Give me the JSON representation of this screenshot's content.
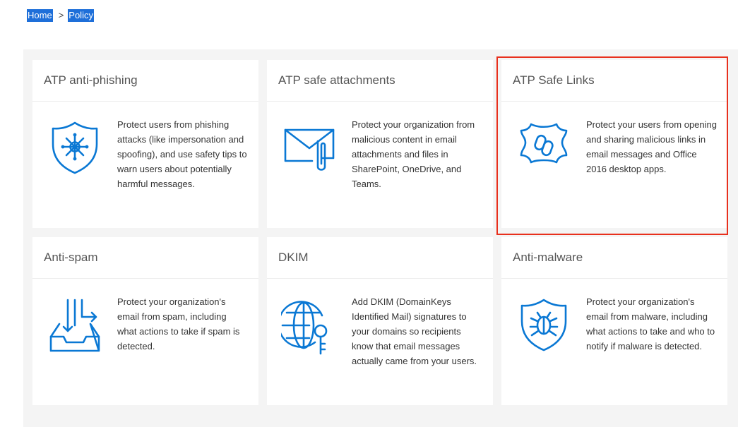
{
  "breadcrumb": {
    "home": "Home",
    "separator": ">",
    "current": "Policy"
  },
  "colors": {
    "accent": "#0a78d4",
    "highlight": "#e8301d",
    "breadcrumb_bg": "#1e6fd9"
  },
  "cards": [
    {
      "title": "ATP anti-phishing",
      "icon": "shield-phishing-icon",
      "description": "Protect users from phishing attacks (like impersonation and spoofing), and use safety tips to warn users about potentially harmful messages."
    },
    {
      "title": "ATP safe attachments",
      "icon": "envelope-paperclip-icon",
      "description": "Protect your organization from malicious content in email attachments and files in SharePoint, OneDrive, and Teams."
    },
    {
      "title": "ATP Safe Links",
      "icon": "shield-link-icon",
      "description": "Protect your users from opening and sharing malicious links in email messages and Office 2016 desktop apps."
    },
    {
      "title": "Anti-spam",
      "icon": "inbox-spam-icon",
      "description": "Protect your organization's email from spam, including what actions to take if spam is detected."
    },
    {
      "title": "DKIM",
      "icon": "globe-key-icon",
      "description": "Add DKIM (DomainKeys Identified Mail) signatures to your domains so recipients know that email messages actually came from your users."
    },
    {
      "title": "Anti-malware",
      "icon": "shield-bug-icon",
      "description": "Protect your organization's email from malware, including what actions to take and who to notify if malware is detected."
    }
  ]
}
